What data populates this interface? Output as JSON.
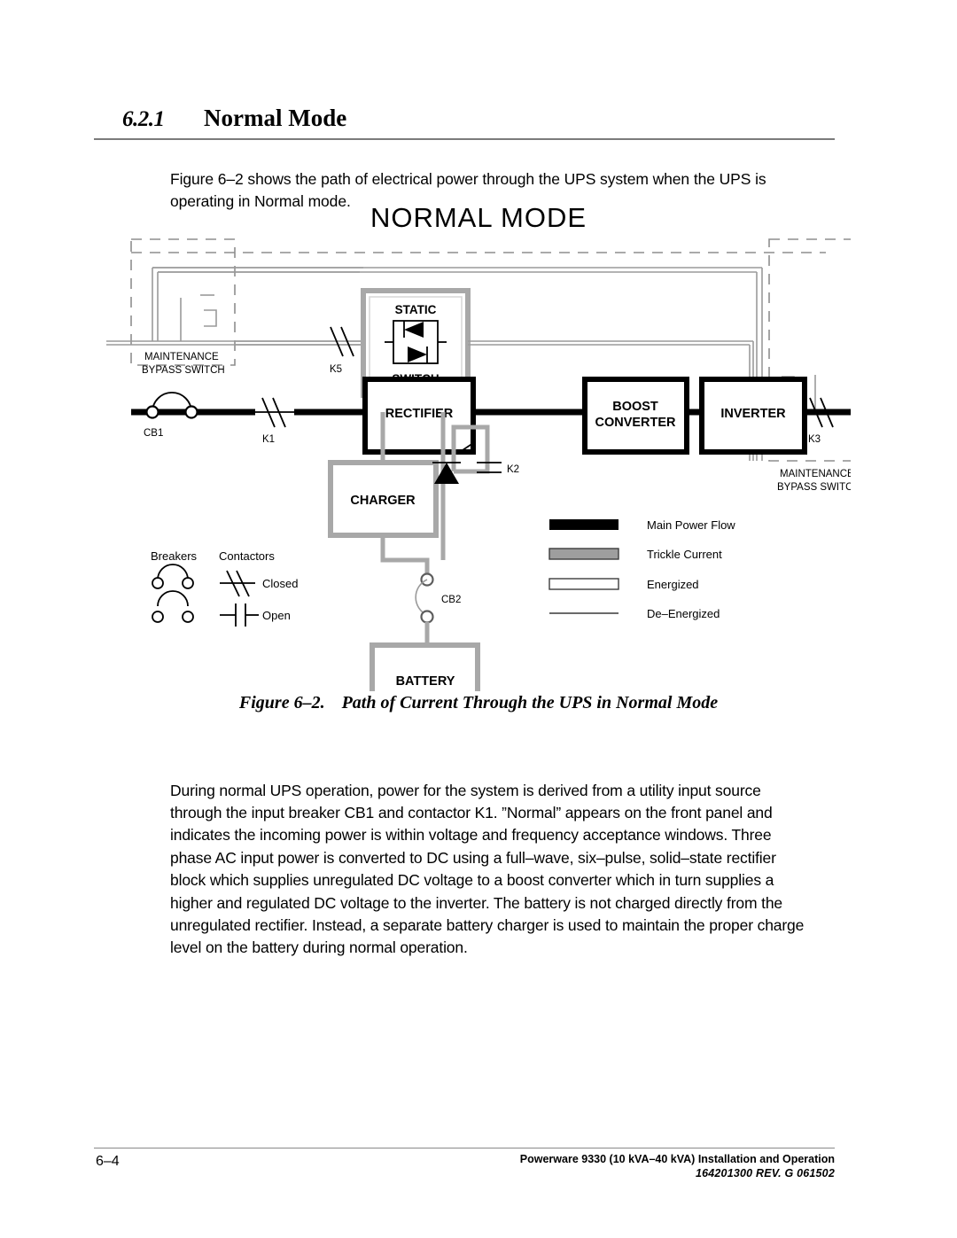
{
  "section": {
    "number": "6.2.1",
    "title": "Normal Mode",
    "intro": "Figure 6–2 shows the path of electrical power through the UPS system when the UPS is operating in Normal mode."
  },
  "figure": {
    "diagram_title": "NORMAL MODE",
    "caption_label": "Figure 6–2.",
    "caption_text": "Path of Current Through the UPS in Normal Mode",
    "blocks": {
      "rectifier": "RECTIFIER",
      "boost_converter_line1": "BOOST",
      "boost_converter_line2": "CONVERTER",
      "inverter": "INVERTER",
      "charger": "CHARGER",
      "battery": "BATTERY",
      "static_switch_line1": "STATIC",
      "static_switch_line2": "SWITCH"
    },
    "labels": {
      "cb1": "CB1",
      "k1": "K1",
      "k5": "K5",
      "k3": "K3",
      "k2": "K2",
      "cb2": "CB2",
      "maintenance_bypass_left_line1": "MAINTENANCE",
      "maintenance_bypass_left_line2": "BYPASS SWITCH",
      "maintenance_bypass_right_line1": "MAINTENANCE",
      "maintenance_bypass_right_line2": "BYPASS SWITCH"
    },
    "symbol_key": {
      "breakers_header": "Breakers",
      "contactors_header": "Contactors",
      "closed": "Closed",
      "open": "Open"
    },
    "legend": [
      {
        "label": "Main Power Flow",
        "style": "solid-black",
        "color": "#000000"
      },
      {
        "label": "Trickle Current",
        "style": "gray-fill",
        "color": "#9e9e9e"
      },
      {
        "label": "Energized",
        "style": "white-outline",
        "color": "#ffffff"
      },
      {
        "label": "De–Energized",
        "style": "thin-line",
        "color": "#555555"
      }
    ]
  },
  "body": {
    "paragraph": "During normal UPS operation, power for the system is derived from a utility input source through the input breaker CB1 and contactor K1. ”Normal” appears on the front panel and indicates the incoming power is within voltage and frequency acceptance windows. Three phase AC input power is converted to DC using a full–wave, six–pulse, solid–state rectifier block which supplies unregulated DC voltage to a boost converter which in turn supplies a higher and regulated DC voltage to the inverter.  The battery is not charged directly from the unregulated rectifier.  Instead, a separate battery charger is used to maintain the proper charge level on the battery during normal operation."
  },
  "footer": {
    "page_number": "6–4",
    "product_line": "Powerware 9330 (10 kVA–40 kVA) Installation and Operation",
    "doc_id": "164201300 REV. G  061502"
  }
}
